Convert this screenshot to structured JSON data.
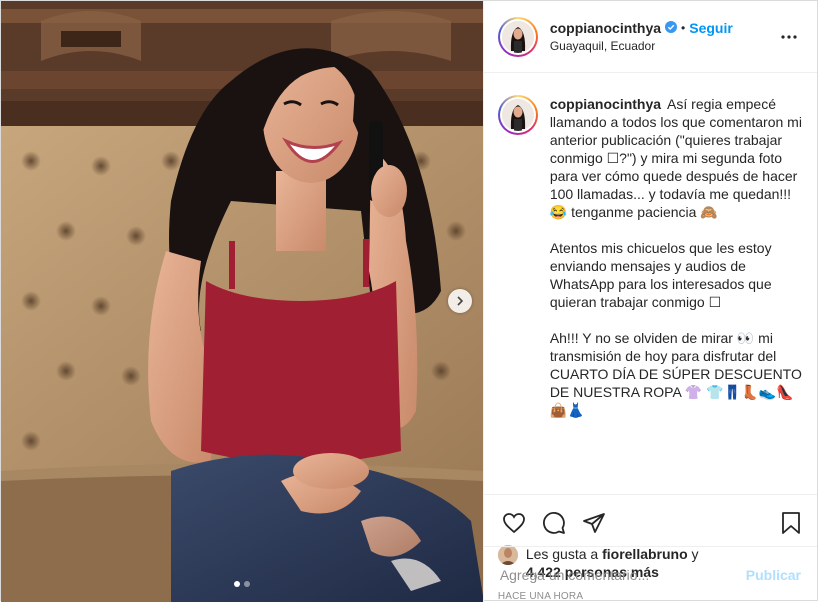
{
  "post": {
    "username": "coppianocinthya",
    "follow_label": "Seguir",
    "separator": "•",
    "location": "Guayaquil, Ecuador",
    "caption_paragraphs": [
      "Así regia empecé llamando a todos los que comentaron mi anterior publicación (\"quieres trabajar conmigo ☐?\") y mira mi segunda foto para ver cómo quede después de hacer 100 llamadas... y todavía me quedan!!! 😂 tenganme paciencia 🙈",
      "Atentos mis chicuelos que les estoy enviando mensajes y audios de WhatsApp para los interesados que quieran trabajar conmigo ☐",
      "Ah!!! Y no se olviden de mirar 👀 mi transmisión de hoy para disfrutar del CUARTO DÍA DE SÚPER DESCUENTO DE NUESTRA ROPA 👚 👕👖👢👟👠👜👗"
    ],
    "likes": {
      "prefix": "Les gusta a ",
      "first_user": "fiorellabruno",
      "middle": " y",
      "others": "4,422 personas más"
    },
    "timestamp": "HACE UNA HORA",
    "comment": {
      "placeholder": "Agrega un comentario...",
      "publish_label": "Publicar"
    },
    "carousel": {
      "total": 2,
      "current": 1
    },
    "colors": {
      "link_blue": "#0095f6",
      "publish_disabled": "#b2dffc",
      "muted": "#8e8e8e",
      "top_red": "#a01f32"
    }
  },
  "icons": {
    "verified": "verified-badge-icon",
    "more": "more-options-icon",
    "like": "heart-icon",
    "comment": "comment-icon",
    "share": "share-icon",
    "save": "bookmark-icon",
    "next": "chevron-right-icon"
  }
}
